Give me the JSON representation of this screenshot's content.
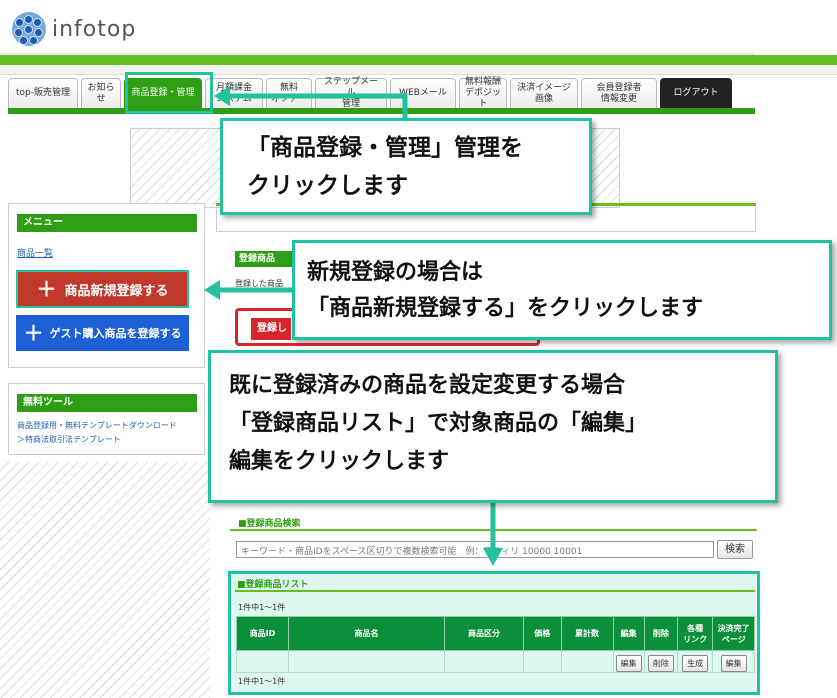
{
  "header": {
    "logo_text": "infotop"
  },
  "nav": {
    "tabs": [
      {
        "label": "top-販売管理"
      },
      {
        "label": "お知らせ"
      },
      {
        "label": "商品登録・管理",
        "active": true
      },
      {
        "label": "月額課金\nシステム"
      },
      {
        "label": "無料\nオファー"
      },
      {
        "label": "ステップメール\n管理"
      },
      {
        "label": "WEBメール"
      },
      {
        "label": "無料報酬\nデポジット"
      },
      {
        "label": "決済イメージ\n画像"
      },
      {
        "label": "会員登録者\n情報変更"
      },
      {
        "label": "ログアウト"
      }
    ]
  },
  "sidebar": {
    "menu_title": "メニュー",
    "menu_link": "商品一覧",
    "new_button": "商品新規登録する",
    "guest_button": "ゲスト購入商品を登録する",
    "tools_title": "無料ツール",
    "tools_link1": "商品登録用・無料テンプレートダウンロード",
    "tools_link2": "＞特商法取引法テンプレート"
  },
  "main": {
    "reg_label": "登録商品",
    "reg_text": "登録した商品",
    "red_button": "登録し"
  },
  "search": {
    "title": "■登録商品検索",
    "placeholder": "キーワード・商品IDをスペース区切りで複数検索可能　例：アフィリ 10000 10001",
    "button": "検索"
  },
  "list": {
    "title": "■登録商品リスト",
    "count": "1件中1～1件",
    "columns": [
      "商品ID",
      "商品名",
      "商品区分",
      "価格",
      "累計数",
      "編集",
      "削除",
      "各種\nリンク",
      "決済完了\nページ"
    ],
    "row_buttons": {
      "edit": "編集",
      "delete": "削除",
      "generate": "生成",
      "edit2": "編集"
    }
  },
  "callouts": {
    "c1": "「商品登録・管理」管理を\nクリックします",
    "c2": "新規登録の場合は\n「商品新規登録する」をクリックします",
    "c3": "既に登録済みの商品を設定変更する場合\n「登録商品リスト」で対象商品の「編集」\n編集をクリックします"
  },
  "colors": {
    "accent": "#22c1a0",
    "green": "#2f9e15",
    "red": "#c0392b",
    "blue": "#1f5fd6"
  }
}
